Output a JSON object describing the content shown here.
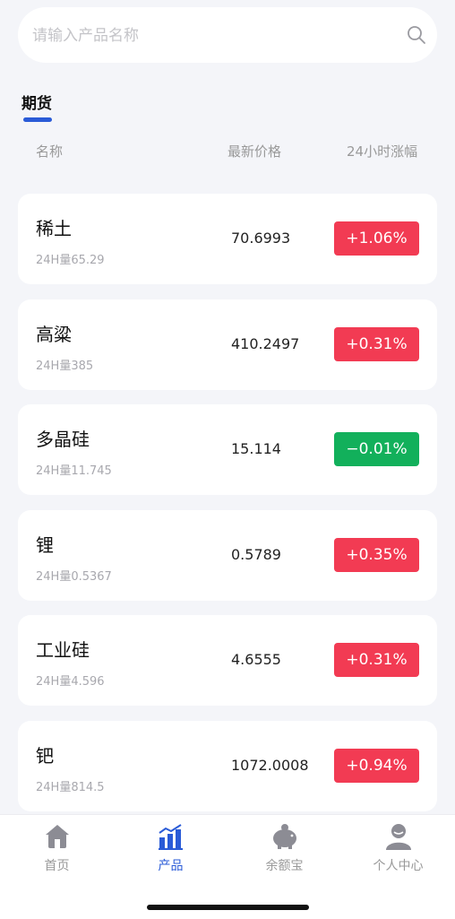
{
  "search": {
    "placeholder": "请输入产品名称"
  },
  "tab": {
    "label": "期货"
  },
  "headers": {
    "name": "名称",
    "price": "最新价格",
    "change": "24小时涨幅"
  },
  "colors": {
    "up": "#f23b53",
    "down": "#12b05b",
    "accent": "#2a5bd7"
  },
  "items": [
    {
      "name": "稀土",
      "vol": "24H量65.29",
      "price": "70.6993",
      "change": "+1.06%",
      "dir": "up"
    },
    {
      "name": "高粱",
      "vol": "24H量385",
      "price": "410.2497",
      "change": "+0.31%",
      "dir": "up"
    },
    {
      "name": "多晶硅",
      "vol": "24H量11.745",
      "price": "15.114",
      "change": "−0.01%",
      "dir": "down"
    },
    {
      "name": "锂",
      "vol": "24H量0.5367",
      "price": "0.5789",
      "change": "+0.35%",
      "dir": "up"
    },
    {
      "name": "工业硅",
      "vol": "24H量4.596",
      "price": "4.6555",
      "change": "+0.31%",
      "dir": "up"
    },
    {
      "name": "钯",
      "vol": "24H量814.5",
      "price": "1072.0008",
      "change": "+0.94%",
      "dir": "up"
    }
  ],
  "nav": [
    {
      "label": "首页",
      "icon": "home-icon"
    },
    {
      "label": "产品",
      "icon": "chart-icon",
      "active": true
    },
    {
      "label": "余额宝",
      "icon": "piggy-bank-icon"
    },
    {
      "label": "个人中心",
      "icon": "user-icon"
    }
  ]
}
